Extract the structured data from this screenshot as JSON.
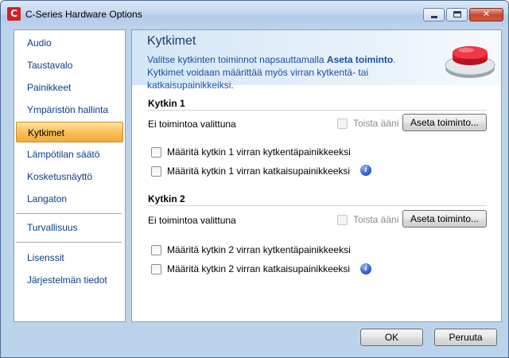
{
  "window": {
    "title": "C-Series Hardware Options",
    "app_icon_letter": "C"
  },
  "title_controls": {
    "minimize": "minimize",
    "maximize": "maximize",
    "close": "✕"
  },
  "sidebar": {
    "items": [
      {
        "label": "Audio"
      },
      {
        "label": "Taustavalo"
      },
      {
        "label": "Painikkeet"
      },
      {
        "label": "Ympäristön hallinta"
      },
      {
        "label": "Kytkimet",
        "selected": true
      },
      {
        "label": "Lämpötilan säätö"
      },
      {
        "label": "Kosketusnäyttö"
      },
      {
        "label": "Langaton"
      },
      {
        "label": "Turvallisuus"
      },
      {
        "label": "Lisenssit"
      },
      {
        "label": "Järjestelmän tiedot"
      }
    ]
  },
  "header": {
    "title": "Kytkimet",
    "desc_part1": "Valitse kytkinten toiminnot napsauttamalla ",
    "desc_bold": "Aseta toiminto",
    "desc_part2": ". Kytkimet voidaan määrittää myös virran kytkentä- tai katkaisupainikkeiksi."
  },
  "switch1": {
    "title": "Kytkin 1",
    "status": "Ei toimintoa valittuna",
    "sound_label": "Toista ääni",
    "set_button": "Aseta toiminto...",
    "option_on": "Määritä kytkin 1 virran kytkentäpainikkeeksi",
    "option_off": "Määritä kytkin 1 virran katkaisupainikkeeksi"
  },
  "switch2": {
    "title": "Kytkin 2",
    "status": "Ei toimintoa valittuna",
    "sound_label": "Toista ääni",
    "set_button": "Aseta toiminto...",
    "option_on": "Määritä kytkin 2 virran kytkentäpainikkeeksi",
    "option_off": "Määritä kytkin 2 virran katkaisupainikkeeksi"
  },
  "info_icon_glyph": "i",
  "footer": {
    "ok": "OK",
    "cancel": "Peruuta"
  },
  "colors": {
    "accent_selected": "#f9c15b",
    "link_blue": "#0b3b8a",
    "device_red": "#d81e2a"
  }
}
